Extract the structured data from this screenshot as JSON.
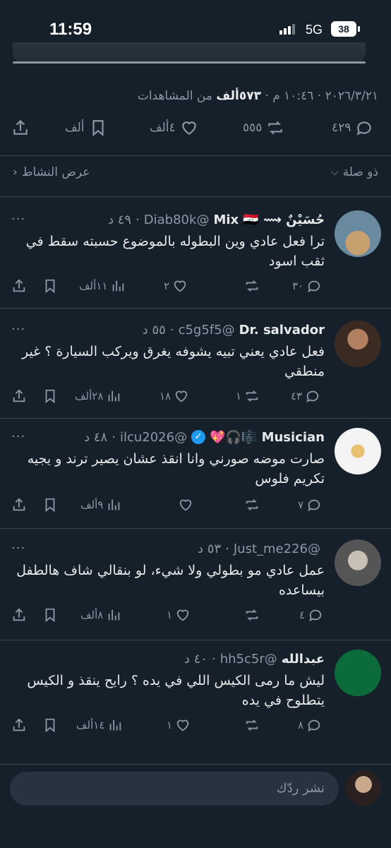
{
  "status_bar": {
    "time": "11:59",
    "network": "5G",
    "battery": "38"
  },
  "tweet": {
    "date": "٢٠٢٦/٣/٢١",
    "time": "١٠:٤٦ م",
    "views_count": "٥٧٣ألف",
    "views_label": "من المشاهدات",
    "separator": " · ",
    "stats": {
      "replies": "٤٢٩",
      "retweets": "٥٥٥",
      "likes": "٤ألف",
      "bookmarks": "ألف"
    }
  },
  "activity": {
    "filter_label": "ذو صلة",
    "view_activity": "عرض النشاط"
  },
  "replies": [
    {
      "name": "حُسَيْنٌ ⟿ Mix 🇮🇶",
      "handle": "@Diab80k",
      "time": "٤٩ د",
      "text": "ترا فعل عادي وين البطوله بالموضوع حسبته سقط في ثقب اسود",
      "replies": "٣٠",
      "retweets": "",
      "likes": "٢",
      "views": "١١ألف"
    },
    {
      "name": "Dr. salvador",
      "handle": "@c5g5f5",
      "time": "٥٥ د",
      "text": "فعل عادي يعني تبيه يشوفه يغرق ويركب السيارة ؟ غير منطقي",
      "replies": "٤٣",
      "retweets": "١",
      "likes": "١٨",
      "views": "٢٨ألف"
    },
    {
      "name": "Musician 🎼🎧💖",
      "handle": "@ilcu2026",
      "time": "٤٨ د",
      "text": "صارت موضه صورني وانا انقذ عشان يصير ترند و يجيه تكريم فلوس",
      "replies": "٧",
      "retweets": "",
      "likes": "",
      "views": "٩ألف",
      "verified": true
    },
    {
      "name": "",
      "handle": "@Just_me226",
      "time": "٥٣ د",
      "text": "عمل عادي مو بطولي ولا شيء، لو بنقالي شاف هالطفل بيساعده",
      "replies": "٤",
      "retweets": "",
      "likes": "١",
      "views": "٨ألف"
    },
    {
      "name": "عبدالله",
      "handle": "@hh5c5r",
      "time": "٤٠ د",
      "text": "ليش ما رمى الكيس اللي في يده ؟ رايح ينقذ و الكيس يتطلوح في يده",
      "replies": "٨",
      "retweets": "",
      "likes": "١",
      "views": "١٤ألف"
    }
  ],
  "composer": {
    "placeholder": "نشر ردّك"
  },
  "more_label": "···",
  "colors": {
    "background": "#15202b",
    "text": "#e7e9ea",
    "muted": "#8b98a5",
    "divider": "#38444d",
    "verified": "#1d9bf0"
  }
}
